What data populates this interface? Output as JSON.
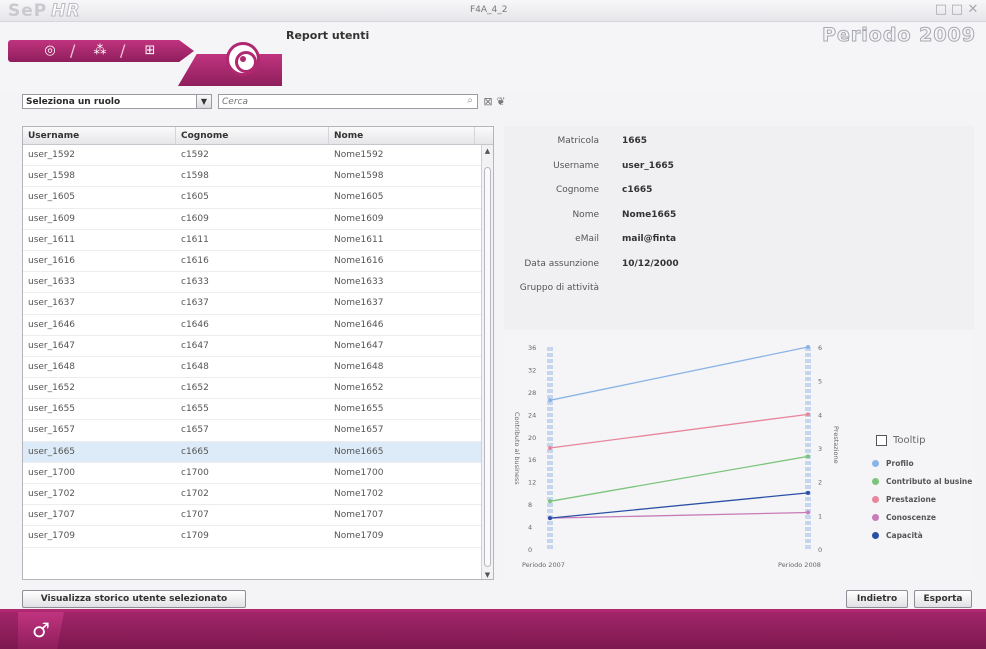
{
  "app": {
    "logo": "SeP",
    "logo_suffix": "HR",
    "window_title": "F4A_4_2"
  },
  "window_controls": [
    "□",
    "□",
    "✕"
  ],
  "header": {
    "page_title": "Report utenti",
    "period": "Periodo 2009"
  },
  "breadcrumbs": [
    "◎",
    "⁂",
    "⊞"
  ],
  "filters": {
    "role_select": "Seleziona un ruolo",
    "search_placeholder": "Cerca"
  },
  "table": {
    "columns": [
      "Username",
      "Cognome",
      "Nome"
    ],
    "rows": [
      [
        "user_1592",
        "c1592",
        "Nome1592"
      ],
      [
        "user_1598",
        "c1598",
        "Nome1598"
      ],
      [
        "user_1605",
        "c1605",
        "Nome1605"
      ],
      [
        "user_1609",
        "c1609",
        "Nome1609"
      ],
      [
        "user_1611",
        "c1611",
        "Nome1611"
      ],
      [
        "user_1616",
        "c1616",
        "Nome1616"
      ],
      [
        "user_1633",
        "c1633",
        "Nome1633"
      ],
      [
        "user_1637",
        "c1637",
        "Nome1637"
      ],
      [
        "user_1646",
        "c1646",
        "Nome1646"
      ],
      [
        "user_1647",
        "c1647",
        "Nome1647"
      ],
      [
        "user_1648",
        "c1648",
        "Nome1648"
      ],
      [
        "user_1652",
        "c1652",
        "Nome1652"
      ],
      [
        "user_1655",
        "c1655",
        "Nome1655"
      ],
      [
        "user_1657",
        "c1657",
        "Nome1657"
      ],
      [
        "user_1665",
        "c1665",
        "Nome1665"
      ],
      [
        "user_1700",
        "c1700",
        "Nome1700"
      ],
      [
        "user_1702",
        "c1702",
        "Nome1702"
      ],
      [
        "user_1707",
        "c1707",
        "Nome1707"
      ],
      [
        "user_1709",
        "c1709",
        "Nome1709"
      ]
    ],
    "selected_index": 14
  },
  "detail": [
    {
      "label": "Matricola",
      "value": "1665"
    },
    {
      "label": "Username",
      "value": "user_1665"
    },
    {
      "label": "Cognome",
      "value": "c1665"
    },
    {
      "label": "Nome",
      "value": "Nome1665"
    },
    {
      "label": "eMail",
      "value": "mail@finta"
    },
    {
      "label": "Data assunzione",
      "value": "10/12/2000"
    },
    {
      "label": "Gruppo di attività",
      "value": ""
    }
  ],
  "chart_data": {
    "type": "line",
    "x": [
      "Periodo 2007",
      "Periodo 2008"
    ],
    "ylabel": "Contributo al business",
    "y2label": "Prestazione",
    "ylim": [
      0,
      36
    ],
    "y2lim": [
      0,
      6
    ],
    "yticks": [
      0,
      4,
      8,
      12,
      16,
      20,
      24,
      28,
      32,
      36
    ],
    "y2ticks": [
      0,
      1,
      2,
      3,
      4,
      5,
      6
    ],
    "series": [
      {
        "name": "Profilo",
        "color": "#8ab4e6",
        "values": [
          26.5,
          36
        ]
      },
      {
        "name": "Contributo al busine",
        "color": "#7cc47c",
        "values": [
          8.5,
          16.5
        ]
      },
      {
        "name": "Prestazione",
        "color": "#e8869b",
        "values": [
          18,
          24
        ]
      },
      {
        "name": "Conoscenze",
        "color": "#c77bb8",
        "values": [
          5.5,
          6.5
        ]
      },
      {
        "name": "Capacità",
        "color": "#2b4fa5",
        "values": [
          5.5,
          10
        ]
      }
    ],
    "legend_toggle": "Tooltip",
    "legend_position": "right"
  },
  "buttons": {
    "history": "Visualizza storico utente selezionato",
    "back": "Indietro",
    "export": "Esporta"
  }
}
